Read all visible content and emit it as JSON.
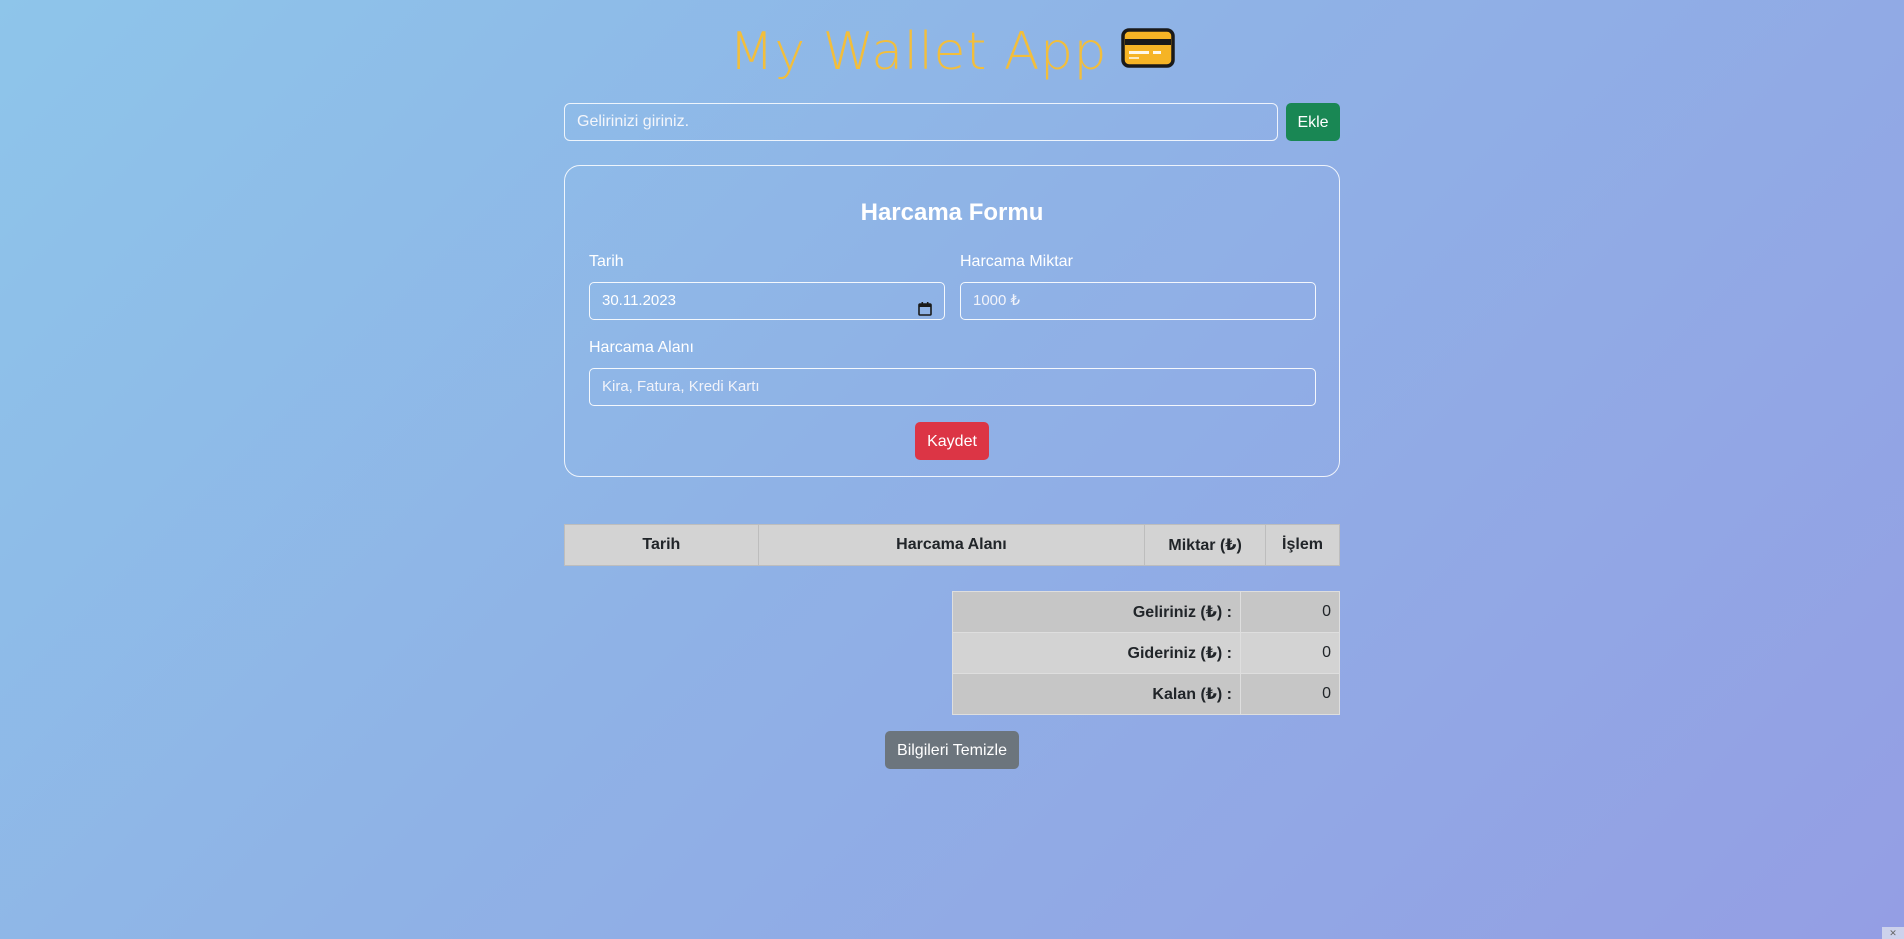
{
  "header": {
    "title": "My Wallet App",
    "icon": "credit-card-icon"
  },
  "income": {
    "placeholder": "Gelirinizi giriniz.",
    "add_label": "Ekle"
  },
  "expense_form": {
    "title": "Harcama Formu",
    "date_label": "Tarih",
    "date_value": "30.11.2023",
    "amount_label": "Harcama Miktar",
    "amount_placeholder": "1000 ₺",
    "area_label": "Harcama Alanı",
    "area_placeholder": "Kira, Fatura, Kredi Kartı",
    "save_label": "Kaydet"
  },
  "expense_table": {
    "headers": [
      "Tarih",
      "Harcama Alanı",
      "Miktar (₺)",
      "İşlem"
    ]
  },
  "summary": {
    "rows": [
      {
        "label": "Geliriniz (₺) :",
        "value": "0"
      },
      {
        "label": "Gideriniz (₺) :",
        "value": "0"
      },
      {
        "label": "Kalan (₺) :",
        "value": "0"
      }
    ]
  },
  "clear_label": "Bilgileri Temizle",
  "colors": {
    "title": "#f2be3c",
    "add_button": "#198754",
    "save_button": "#dc3545",
    "clear_button": "#6c757d"
  }
}
